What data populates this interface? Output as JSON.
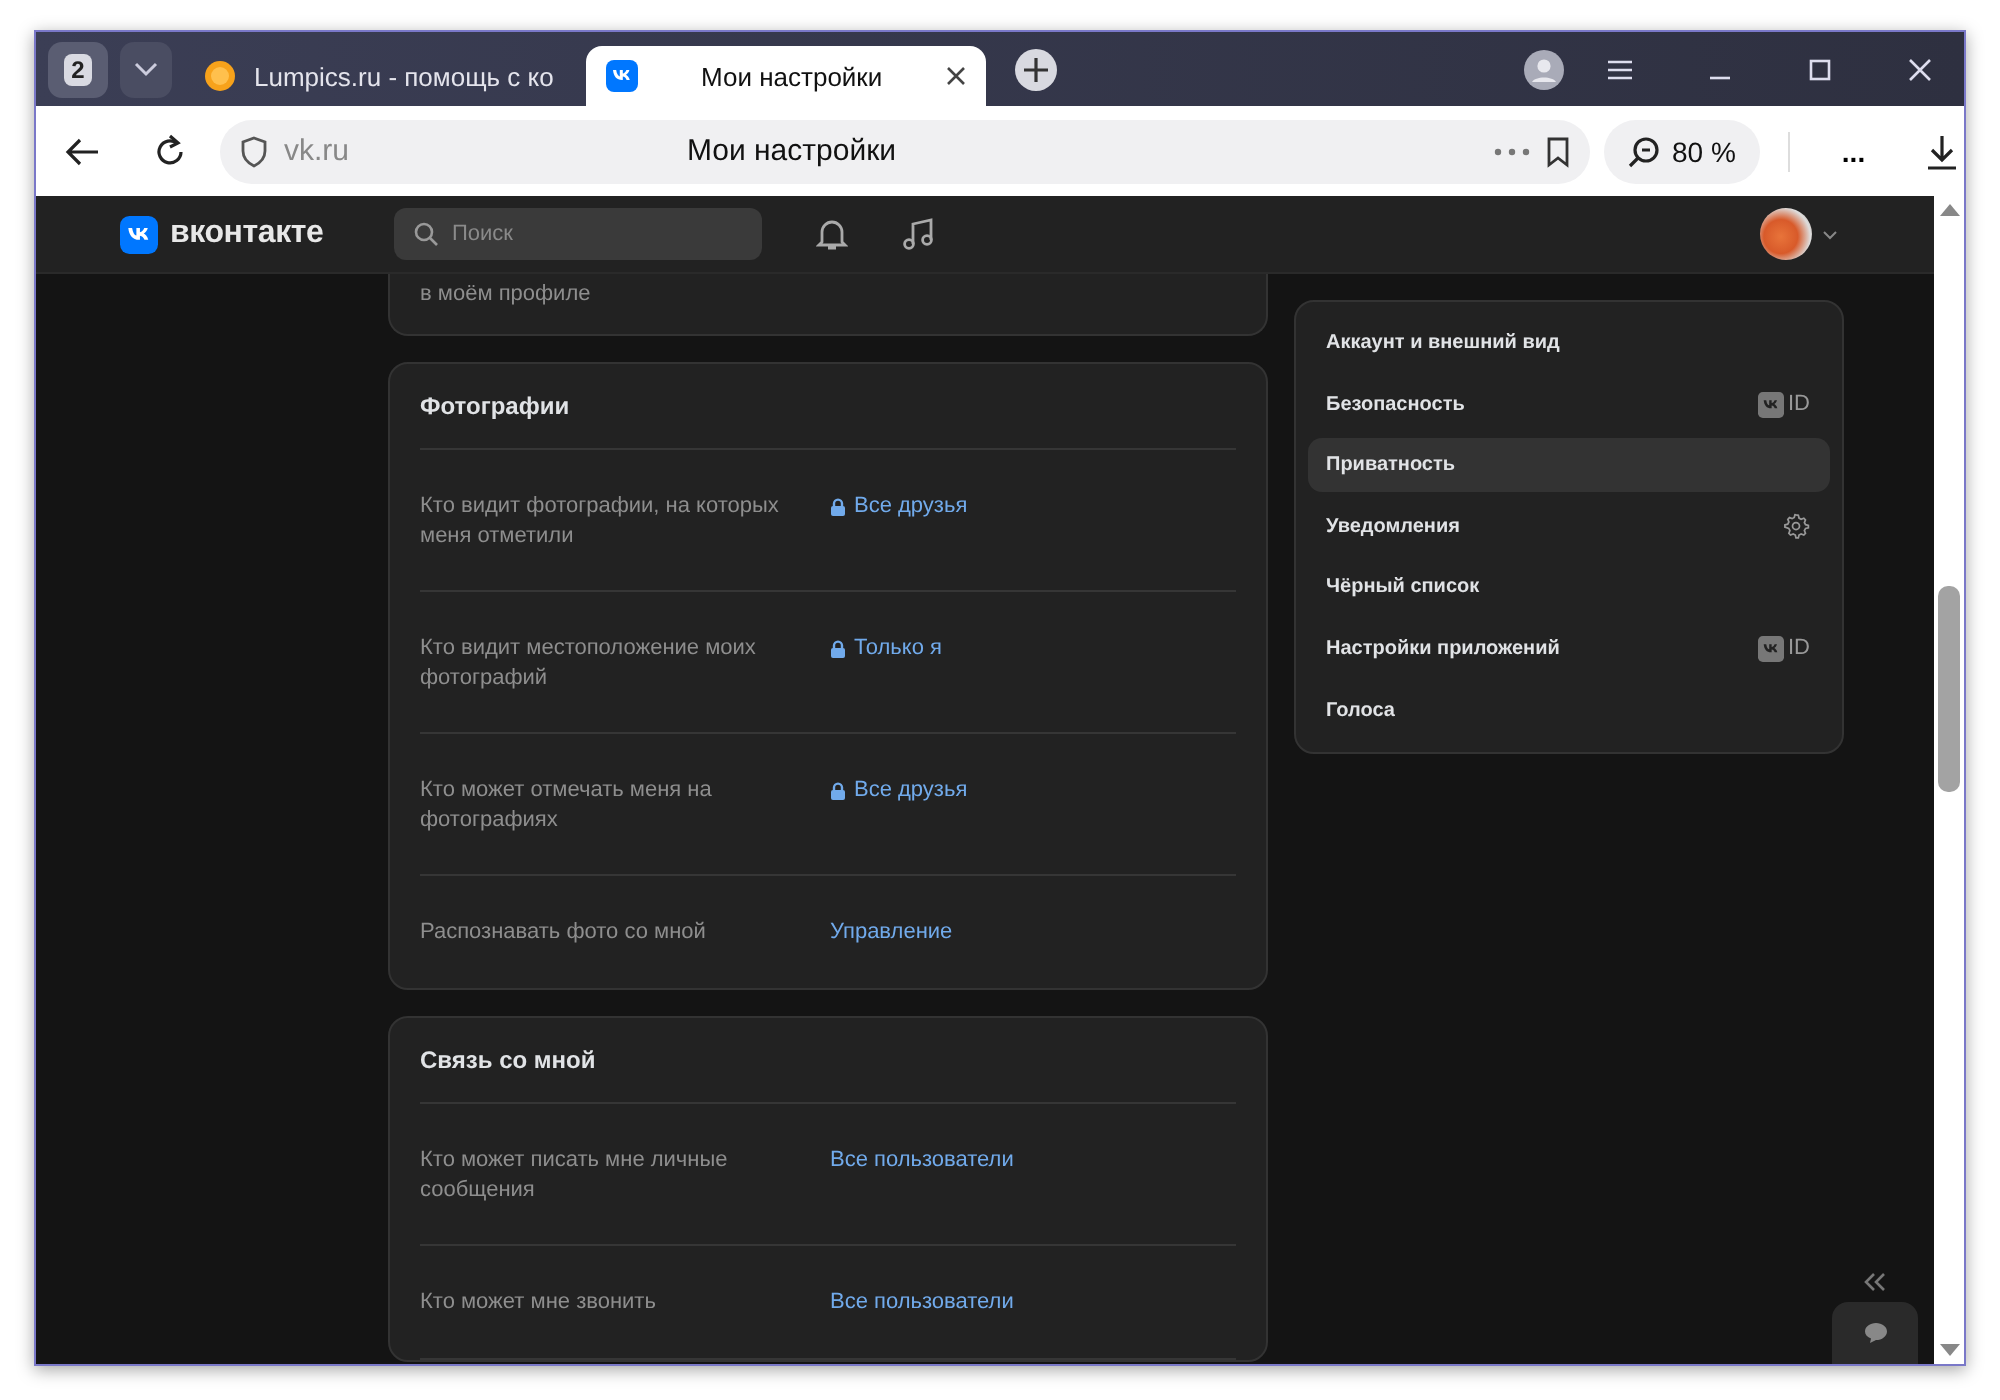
{
  "browser": {
    "tab_counter": "2",
    "tabs": [
      {
        "title": "Lumpics.ru - помощь с ко",
        "kind": "lumpics",
        "selected": false
      },
      {
        "title": "Мои настройки",
        "kind": "vk",
        "selected": true
      }
    ],
    "address": {
      "domain": "vk.ru",
      "title": "Мои настройки"
    },
    "zoom": "80 %",
    "more": "..."
  },
  "header": {
    "logo": "вконтакте",
    "search": {
      "placeholder": "Поиск"
    }
  },
  "sections": [
    {
      "partial": true,
      "rows": [
        {
          "label": "в моём профиле"
        }
      ]
    },
    {
      "title": "Фотографии",
      "rows": [
        {
          "label": "Кто видит фотографии, на которых меня отметили",
          "value": "Все друзья",
          "locked": true
        },
        {
          "label": "Кто видит местоположение моих фотографий",
          "value": "Только я",
          "locked": true
        },
        {
          "label": "Кто может отмечать меня на фотографиях",
          "value": "Все друзья",
          "locked": true
        },
        {
          "label": "Распознавать фото со мной",
          "value": "Управление",
          "locked": false
        }
      ]
    },
    {
      "title": "Связь со мной",
      "rows": [
        {
          "label": "Кто может писать мне личные сообщения",
          "value": "Все пользователи",
          "locked": false
        },
        {
          "label": "Кто может мне звонить",
          "value": "Все пользователи",
          "locked": false
        }
      ]
    }
  ],
  "menu": [
    {
      "label": "Аккаунт и внешний вид",
      "selected": false
    },
    {
      "label": "Безопасность",
      "selected": false,
      "kind": "vkid",
      "badge": "ID"
    },
    {
      "label": "Приватность",
      "selected": true
    },
    {
      "label": "Уведомления",
      "selected": false,
      "kind": "gear"
    },
    {
      "label": "Чёрный список",
      "selected": false
    },
    {
      "label": "Настройки приложений",
      "selected": false,
      "kind": "vkid",
      "badge": "ID"
    },
    {
      "label": "Голоса",
      "selected": false
    }
  ]
}
